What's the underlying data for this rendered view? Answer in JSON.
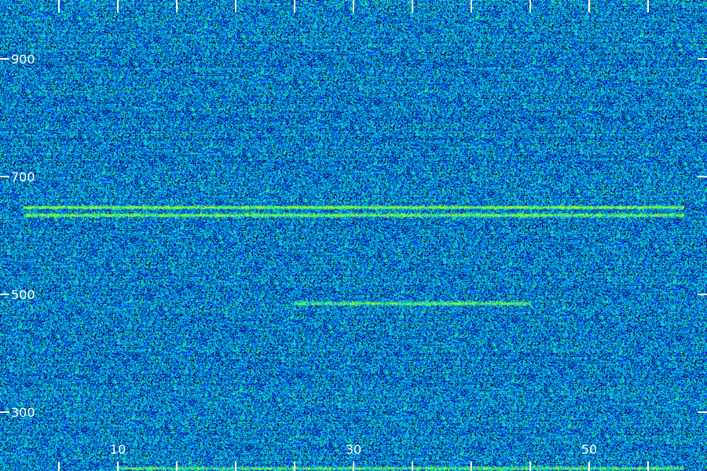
{
  "chart_data": {
    "type": "heatmap",
    "title": "",
    "xlabel": "",
    "ylabel": "",
    "x_tick_labels": [
      {
        "value": 10,
        "label": "10"
      },
      {
        "value": 30,
        "label": "30"
      },
      {
        "value": 50,
        "label": "50"
      }
    ],
    "x_minor_ticks": [
      5,
      10,
      15,
      20,
      25,
      30,
      35,
      40,
      45,
      50,
      55
    ],
    "y_tick_labels": [
      {
        "value": 900,
        "label": "900"
      },
      {
        "value": 700,
        "label": "700"
      },
      {
        "value": 500,
        "label": "500"
      },
      {
        "value": 300,
        "label": "300"
      }
    ],
    "xlim": [
      0,
      60
    ],
    "ylim": [
      200,
      1000
    ],
    "grid": false,
    "colormap": [
      "#000000",
      "#000080",
      "#0040ff",
      "#00a0ff",
      "#00e0c0",
      "#40ff60",
      "#c0ff00"
    ],
    "noise_level": 0.45,
    "highlighted_bands": [
      {
        "y_value": 648,
        "x_start": 2,
        "x_end": 58,
        "intensity": 0.85
      },
      {
        "y_value": 635,
        "x_start": 2,
        "x_end": 58,
        "intensity": 0.75
      },
      {
        "y_value": 485,
        "x_start": 25,
        "x_end": 45,
        "intensity": 0.7
      },
      {
        "y_value": 205,
        "x_start": 10,
        "x_end": 58,
        "intensity": 0.6
      }
    ]
  }
}
